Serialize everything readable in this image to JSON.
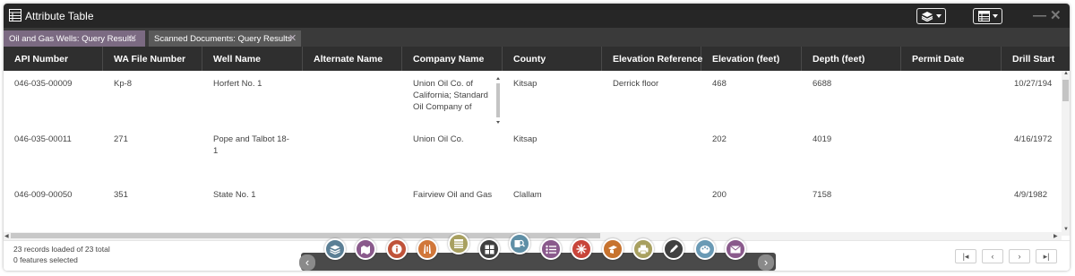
{
  "window": {
    "title": "Attribute Table",
    "minimize_glyph": "—",
    "close_glyph": "✕"
  },
  "tabs": [
    {
      "label": "Oil and Gas Wells: Query Results",
      "active": true
    },
    {
      "label": "Scanned Documents: Query Results",
      "active": false
    }
  ],
  "tab_close_glyph": "✕",
  "columns": [
    "API Number",
    "WA File Number",
    "Well Name",
    "Alternate Name",
    "Company Name",
    "County",
    "Elevation Reference",
    "Elevation (feet)",
    "Depth (feet)",
    "Permit Date",
    "Drill Start"
  ],
  "rows": [
    {
      "api": "046-035-00009",
      "wa_file": "Kp-8",
      "well_name": "Horfert No. 1",
      "alt_name": "",
      "company": "Union Oil Co. of California; Standard Oil Company of",
      "county": "Kitsap",
      "elev_ref": "Derrick floor",
      "elev": "468",
      "depth": "6688",
      "permit": "",
      "drill_start": "10/27/194"
    },
    {
      "api": "046-035-00011",
      "wa_file": "271",
      "well_name": "Pope and Talbot 18-1",
      "alt_name": "",
      "company": "Union Oil Co.",
      "county": "Kitsap",
      "elev_ref": "",
      "elev": "202",
      "depth": "4019",
      "permit": "",
      "drill_start": "4/16/1972"
    },
    {
      "api": "046-009-00050",
      "wa_file": "351",
      "well_name": "State No. 1",
      "alt_name": "",
      "company": "Fairview Oil and Gas",
      "county": "Clallam",
      "elev_ref": "",
      "elev": "200",
      "depth": "7158",
      "permit": "",
      "drill_start": "4/9/1982"
    }
  ],
  "footer": {
    "records_text": "23 records loaded of 23 total",
    "selected_text": "0 features selected"
  },
  "toolbar_icons": [
    {
      "name": "layers-icon",
      "color": "#5b7f95"
    },
    {
      "name": "basemap-icon",
      "color": "#8a5a8c"
    },
    {
      "name": "info-icon",
      "color": "#c0533a"
    },
    {
      "name": "oil-well-icon",
      "color": "#d1773a"
    },
    {
      "name": "attribute-table-icon",
      "color": "#a8a060"
    },
    {
      "name": "grid-icon",
      "color": "#404040"
    },
    {
      "name": "search-icon",
      "color": "#5f8fa6"
    },
    {
      "name": "legend-icon",
      "color": "#8a5a8c"
    },
    {
      "name": "draw-icon",
      "color": "#c8453a"
    },
    {
      "name": "measure-icon",
      "color": "#c7732f"
    },
    {
      "name": "print-icon",
      "color": "#a8a060"
    },
    {
      "name": "edit-icon",
      "color": "#404040"
    },
    {
      "name": "share-icon",
      "color": "#6a9ab5"
    },
    {
      "name": "mail-icon",
      "color": "#8a5a8c"
    }
  ],
  "pager": {
    "first": "|◂",
    "prev": "‹",
    "next": "›",
    "last": "▸|"
  },
  "toolbar_nav": {
    "prev": "‹",
    "next": "›"
  }
}
